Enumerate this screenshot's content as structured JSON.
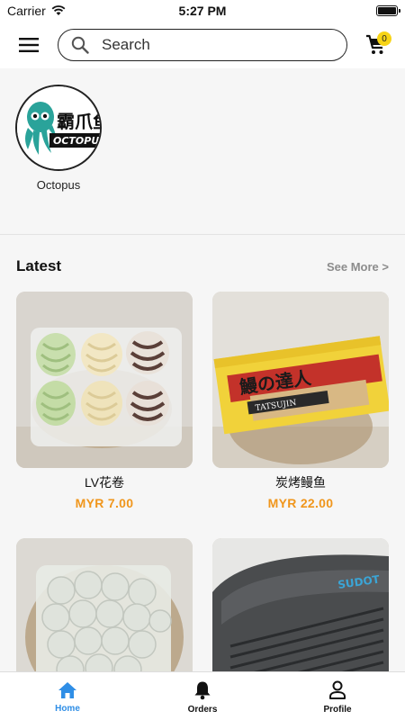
{
  "status_bar": {
    "carrier": "Carrier",
    "time": "5:27 PM"
  },
  "header": {
    "search_label": "Search",
    "cart_count": "0"
  },
  "stores": [
    {
      "name": "Octopus",
      "logo_text": "霸爪鱼",
      "logo_subtext": "OCTOPU"
    }
  ],
  "latest": {
    "title": "Latest",
    "see_more": "See More >",
    "products": [
      {
        "name": "LV花卷",
        "price": "MYR 7.00"
      },
      {
        "name": "炭烤鳗鱼",
        "price": "MYR 22.00",
        "package_text_1": "鰻の達人",
        "package_text_2": "TATSUJIN"
      },
      {
        "name": "",
        "price": ""
      },
      {
        "name": "",
        "price": "",
        "package_text": "SUDOT"
      }
    ]
  },
  "bottom_nav": [
    {
      "label": "Home",
      "icon": "home-icon",
      "active": true
    },
    {
      "label": "Orders",
      "icon": "bell-icon",
      "active": false
    },
    {
      "label": "Profile",
      "icon": "profile-icon",
      "active": false
    }
  ],
  "colors": {
    "price": "#f0961c",
    "active_tab": "#2f8ee6",
    "badge": "#f7d417"
  }
}
